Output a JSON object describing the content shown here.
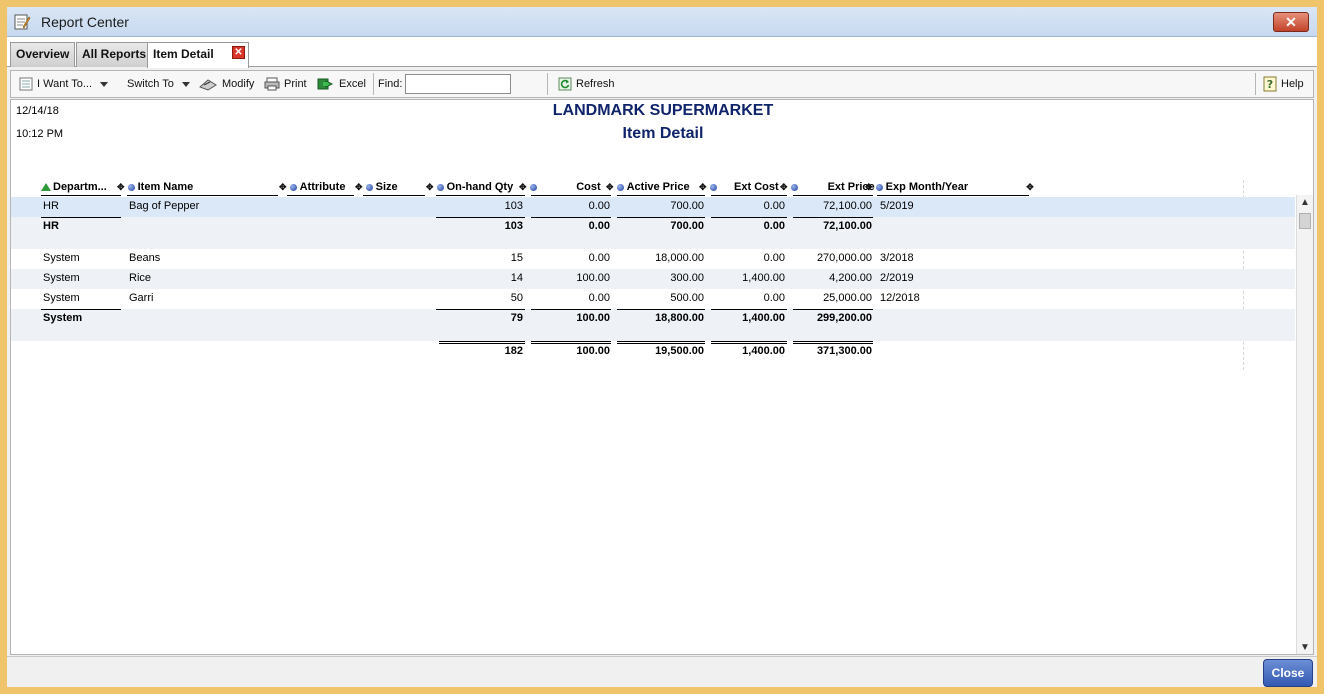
{
  "window": {
    "title": "Report Center",
    "close_glyph": "✕"
  },
  "tabs": [
    {
      "label": "Overview"
    },
    {
      "label": "All Reports"
    },
    {
      "label": "Item Detail"
    }
  ],
  "tab_close_glyph": "✕",
  "toolbar": {
    "i_want_to": "I Want To...",
    "switch_to": "Switch To",
    "modify": "Modify",
    "print": "Print",
    "excel": "Excel",
    "find_label": "Find:",
    "find_value": "",
    "refresh": "Refresh",
    "help": "Help"
  },
  "report": {
    "date": "12/14/18",
    "time": "10:12 PM",
    "company": "LANDMARK SUPERMARKET",
    "name": "Item Detail",
    "columns": [
      "Departm...",
      "Item Name",
      "Attribute",
      "Size",
      "On-hand Qty",
      "Cost",
      "Active Price",
      "Ext Cost",
      "Ext Price",
      "Exp Month/Year"
    ],
    "rows": [
      {
        "dept": "HR",
        "item": "Bag of Pepper",
        "qty": "103",
        "cost": "0.00",
        "active_price": "700.00",
        "ext_cost": "0.00",
        "ext_price": "72,100.00",
        "exp": "5/2019"
      },
      {
        "dept": "HR",
        "item": "",
        "qty": "103",
        "cost": "0.00",
        "active_price": "700.00",
        "ext_cost": "0.00",
        "ext_price": "72,100.00",
        "exp": ""
      },
      {
        "dept": "System",
        "item": "Beans",
        "qty": "15",
        "cost": "0.00",
        "active_price": "18,000.00",
        "ext_cost": "0.00",
        "ext_price": "270,000.00",
        "exp": "3/2018"
      },
      {
        "dept": "System",
        "item": "Rice",
        "qty": "14",
        "cost": "100.00",
        "active_price": "300.00",
        "ext_cost": "1,400.00",
        "ext_price": "4,200.00",
        "exp": "2/2019"
      },
      {
        "dept": "System",
        "item": "Garri",
        "qty": "50",
        "cost": "0.00",
        "active_price": "500.00",
        "ext_cost": "0.00",
        "ext_price": "25,000.00",
        "exp": "12/2018"
      },
      {
        "dept": "System",
        "item": "",
        "qty": "79",
        "cost": "100.00",
        "active_price": "18,800.00",
        "ext_cost": "1,400.00",
        "ext_price": "299,200.00",
        "exp": ""
      }
    ],
    "grand_total": {
      "qty": "182",
      "cost": "100.00",
      "active_price": "19,500.00",
      "ext_cost": "1,400.00",
      "ext_price": "371,300.00"
    }
  },
  "footer": {
    "close": "Close"
  },
  "colors": {
    "title_blue": "#10246b",
    "selected_row": "#dbe8f8",
    "frame": "#f0c46a"
  },
  "icons": [
    "notepad-icon",
    "report-list-icon",
    "modify-icon",
    "printer-icon",
    "excel-export-icon",
    "refresh-icon",
    "help-icon"
  ]
}
